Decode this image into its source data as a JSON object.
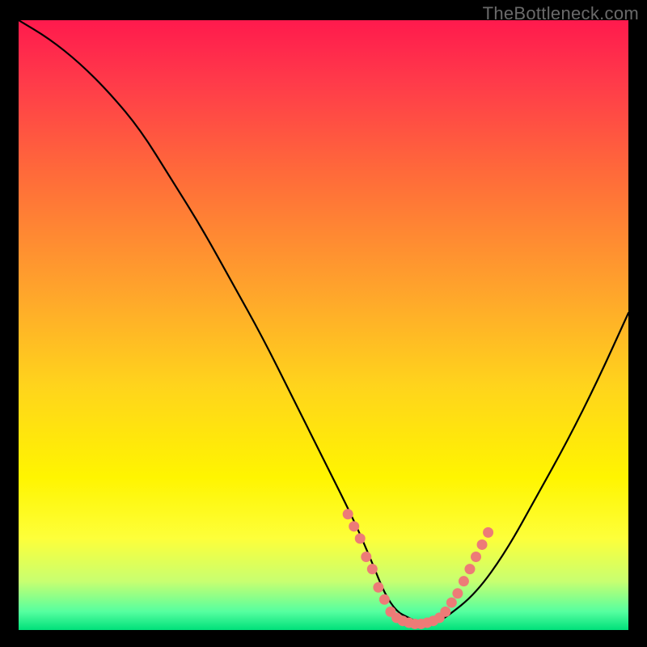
{
  "watermark": "TheBottleneck.com",
  "chart_data": {
    "type": "line",
    "title": "",
    "xlabel": "",
    "ylabel": "",
    "xlim": [
      0,
      100
    ],
    "ylim": [
      0,
      100
    ],
    "series": [
      {
        "name": "bottleneck-curve",
        "x": [
          0,
          5,
          10,
          15,
          20,
          25,
          30,
          35,
          40,
          45,
          50,
          55,
          58,
          60,
          62,
          64,
          66,
          68,
          70,
          75,
          80,
          85,
          90,
          95,
          100
        ],
        "values": [
          100,
          97,
          93,
          88,
          82,
          74,
          66,
          57,
          48,
          38,
          28,
          18,
          11,
          6,
          3,
          2,
          1,
          1,
          2,
          6,
          13,
          22,
          31,
          41,
          52
        ]
      }
    ],
    "overlay": {
      "name": "highlight-dots-near-minimum",
      "color": "#ed7b77",
      "points": [
        {
          "x": 54,
          "y": 19
        },
        {
          "x": 55,
          "y": 17
        },
        {
          "x": 56,
          "y": 15
        },
        {
          "x": 57,
          "y": 12
        },
        {
          "x": 58,
          "y": 10
        },
        {
          "x": 59,
          "y": 7
        },
        {
          "x": 60,
          "y": 5
        },
        {
          "x": 61,
          "y": 3
        },
        {
          "x": 62,
          "y": 2
        },
        {
          "x": 63,
          "y": 1.5
        },
        {
          "x": 64,
          "y": 1.2
        },
        {
          "x": 65,
          "y": 1
        },
        {
          "x": 66,
          "y": 1
        },
        {
          "x": 67,
          "y": 1.2
        },
        {
          "x": 68,
          "y": 1.5
        },
        {
          "x": 69,
          "y": 2
        },
        {
          "x": 70,
          "y": 3
        },
        {
          "x": 71,
          "y": 4.5
        },
        {
          "x": 72,
          "y": 6
        },
        {
          "x": 73,
          "y": 8
        },
        {
          "x": 74,
          "y": 10
        },
        {
          "x": 75,
          "y": 12
        },
        {
          "x": 76,
          "y": 14
        },
        {
          "x": 77,
          "y": 16
        }
      ]
    },
    "background_gradient": {
      "top": "#ff1a4d",
      "middle": "#fff500",
      "bottom": "#00e07a"
    }
  }
}
